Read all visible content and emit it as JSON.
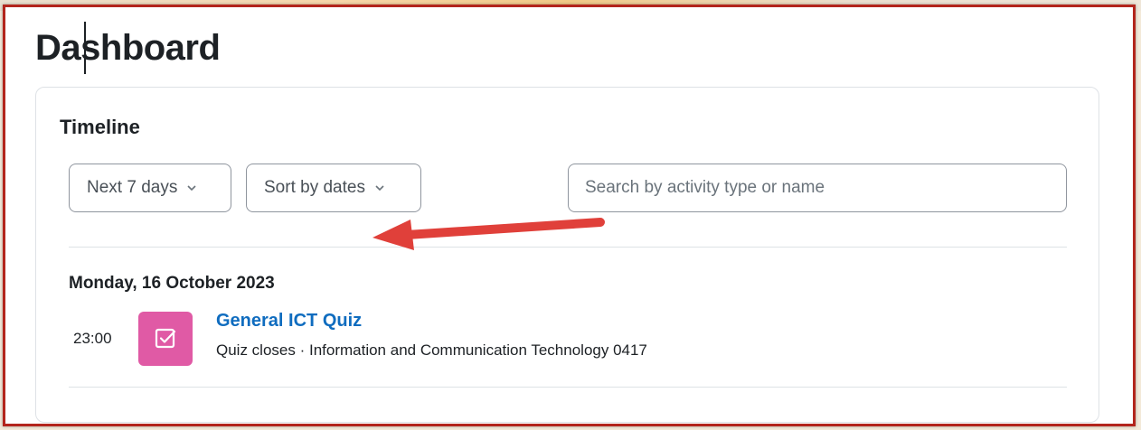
{
  "page": {
    "title": "Dashboard"
  },
  "timeline": {
    "title": "Timeline",
    "filter_days": {
      "selected": "Next 7 days"
    },
    "sort": {
      "selected": "Sort by dates"
    },
    "search": {
      "placeholder": "Search by activity type or name",
      "value": ""
    },
    "groups": [
      {
        "date": "Monday, 16 October 2023",
        "events": [
          {
            "time": "23:00",
            "icon": "quiz-icon",
            "name": "General ICT Quiz",
            "detail": "Quiz closes · Information and Communication Technology 0417"
          }
        ]
      }
    ]
  },
  "annotation": {
    "arrow_color": "#e0403a",
    "frame_color": "#b3251c"
  },
  "colors": {
    "link": "#0f6cbf",
    "quiz_icon_bg": "#e05aa5"
  }
}
